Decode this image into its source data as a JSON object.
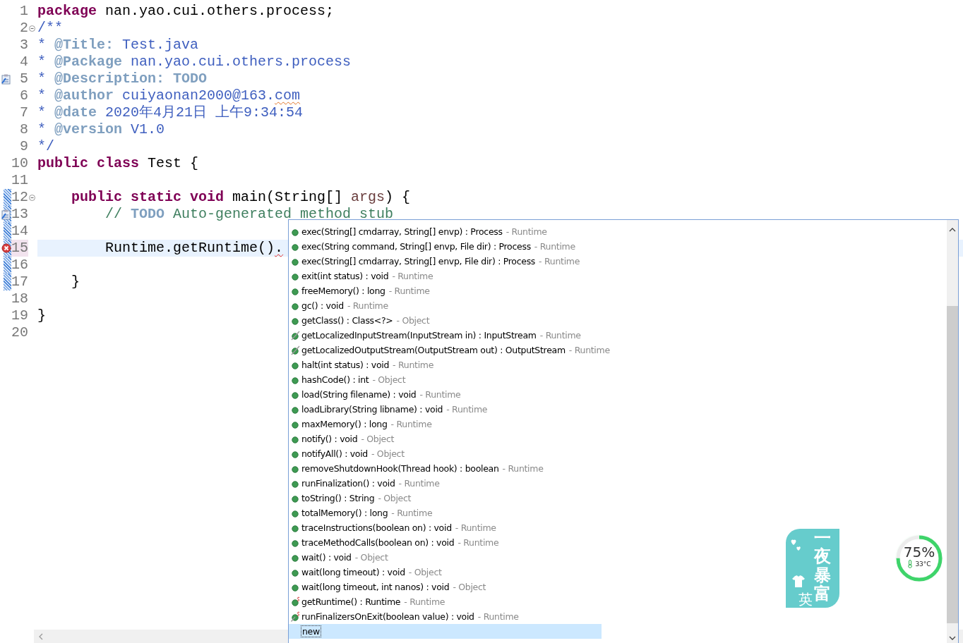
{
  "editor": {
    "lines": [
      {
        "number": "1",
        "segments": [
          {
            "kind": "keyword",
            "text": "package"
          },
          {
            "kind": "plain",
            "text": " nan.yao.cui.others.process;"
          }
        ]
      },
      {
        "number": "2",
        "fold": true,
        "segments": [
          {
            "kind": "doc",
            "text": "/**"
          }
        ]
      },
      {
        "number": "3",
        "segments": [
          {
            "kind": "doc",
            "text": "* "
          },
          {
            "kind": "doc-tag",
            "text": "@Title:"
          },
          {
            "kind": "doc",
            "text": " Test.java"
          }
        ]
      },
      {
        "number": "4",
        "segments": [
          {
            "kind": "doc",
            "text": "* "
          },
          {
            "kind": "doc-tag",
            "text": "@Package"
          },
          {
            "kind": "doc",
            "text": " nan.yao.cui.others.process"
          }
        ]
      },
      {
        "number": "5",
        "task": true,
        "segments": [
          {
            "kind": "doc",
            "text": "* "
          },
          {
            "kind": "doc-tag",
            "text": "@Description:"
          },
          {
            "kind": "doc-tag",
            "text": " TODO"
          }
        ]
      },
      {
        "number": "6",
        "segments": [
          {
            "kind": "doc",
            "text": "* "
          },
          {
            "kind": "doc-tag",
            "text": "@author"
          },
          {
            "kind": "doc",
            "text": " cuiyaonan2000@163."
          },
          {
            "kind": "doc",
            "text": "com",
            "misspelled": true
          }
        ]
      },
      {
        "number": "7",
        "segments": [
          {
            "kind": "doc",
            "text": "* "
          },
          {
            "kind": "doc-tag",
            "text": "@date"
          },
          {
            "kind": "doc",
            "text": " 2020年4月21日 上午9:34:54"
          }
        ]
      },
      {
        "number": "8",
        "segments": [
          {
            "kind": "doc",
            "text": "* "
          },
          {
            "kind": "doc-tag",
            "text": "@version"
          },
          {
            "kind": "doc",
            "text": " V1.0"
          }
        ]
      },
      {
        "number": "9",
        "segments": [
          {
            "kind": "doc",
            "text": "*/"
          }
        ]
      },
      {
        "number": "10",
        "segments": [
          {
            "kind": "keyword",
            "text": "public class"
          },
          {
            "kind": "plain",
            "text": " Test {"
          }
        ]
      },
      {
        "number": "11"
      },
      {
        "number": "12",
        "fold": true,
        "changed": true,
        "segments": [
          {
            "kind": "keyword",
            "text": "    public static void"
          },
          {
            "kind": "plain",
            "text": " main(String[] "
          },
          {
            "kind": "param",
            "text": "args"
          },
          {
            "kind": "plain",
            "text": ") {"
          }
        ]
      },
      {
        "number": "13",
        "changed": true,
        "task": true,
        "segments": [
          {
            "kind": "comment",
            "text": "        // "
          },
          {
            "kind": "task-tag",
            "text": "TODO"
          },
          {
            "kind": "comment",
            "text": " Auto-generated method stub"
          }
        ]
      },
      {
        "number": "14",
        "changed": true
      },
      {
        "number": "15",
        "current": true,
        "changed": true,
        "error": true,
        "segments": [
          {
            "kind": "plain",
            "text": "        Runtime.getRuntime()"
          },
          {
            "kind": "plain",
            "text": ".",
            "error": true
          }
        ]
      },
      {
        "number": "16",
        "changed": true
      },
      {
        "number": "17",
        "changed": true,
        "segments": [
          {
            "kind": "plain",
            "text": "    }"
          }
        ]
      },
      {
        "number": "18"
      },
      {
        "number": "19",
        "segments": [
          {
            "kind": "plain",
            "text": "}"
          }
        ]
      },
      {
        "number": "20"
      }
    ]
  },
  "proposals": [
    {
      "kind": "method",
      "signature": "exec(String[] cmdarray, String[] envp) : Process",
      "owner": "- Runtime",
      "selected": false
    },
    {
      "kind": "method",
      "signature": "exec(String command, String[] envp, File dir) : Process",
      "owner": "- Runtime",
      "selected": false
    },
    {
      "kind": "method",
      "signature": "exec(String[] cmdarray, String[] envp, File dir) : Process",
      "owner": "- Runtime",
      "selected": false
    },
    {
      "kind": "method",
      "signature": "exit(int status) : void",
      "owner": "- Runtime",
      "selected": false
    },
    {
      "kind": "method",
      "signature": "freeMemory() : long",
      "owner": "- Runtime",
      "selected": false
    },
    {
      "kind": "method",
      "signature": "gc() : void",
      "owner": "- Runtime",
      "selected": false
    },
    {
      "kind": "method",
      "signature": "getClass() : Class<?>",
      "owner": "- Object",
      "selected": false
    },
    {
      "kind": "deprecated",
      "signature": "getLocalizedInputStream(InputStream in) : InputStream",
      "owner": "- Runtime",
      "selected": false
    },
    {
      "kind": "deprecated",
      "signature": "getLocalizedOutputStream(OutputStream out) : OutputStream",
      "owner": "- Runtime",
      "selected": false
    },
    {
      "kind": "method",
      "signature": "halt(int status) : void",
      "owner": "- Runtime",
      "selected": false
    },
    {
      "kind": "method",
      "signature": "hashCode() : int",
      "owner": "- Object",
      "selected": false
    },
    {
      "kind": "method",
      "signature": "load(String filename) : void",
      "owner": "- Runtime",
      "selected": false
    },
    {
      "kind": "method",
      "signature": "loadLibrary(String libname) : void",
      "owner": "- Runtime",
      "selected": false
    },
    {
      "kind": "method",
      "signature": "maxMemory() : long",
      "owner": "- Runtime",
      "selected": false
    },
    {
      "kind": "method",
      "signature": "notify() : void",
      "owner": "- Object",
      "selected": false
    },
    {
      "kind": "method",
      "signature": "notifyAll() : void",
      "owner": "- Object",
      "selected": false
    },
    {
      "kind": "method",
      "signature": "removeShutdownHook(Thread hook) : boolean",
      "owner": "- Runtime",
      "selected": false
    },
    {
      "kind": "method",
      "signature": "runFinalization() : void",
      "owner": "- Runtime",
      "selected": false
    },
    {
      "kind": "method",
      "signature": "toString() : String",
      "owner": "- Object",
      "selected": false
    },
    {
      "kind": "method",
      "signature": "totalMemory() : long",
      "owner": "- Runtime",
      "selected": false
    },
    {
      "kind": "method",
      "signature": "traceInstructions(boolean on) : void",
      "owner": "- Runtime",
      "selected": false
    },
    {
      "kind": "method",
      "signature": "traceMethodCalls(boolean on) : void",
      "owner": "- Runtime",
      "selected": false
    },
    {
      "kind": "method",
      "signature": "wait() : void",
      "owner": "- Object",
      "selected": false
    },
    {
      "kind": "method",
      "signature": "wait(long timeout) : void",
      "owner": "- Object",
      "selected": false
    },
    {
      "kind": "method",
      "signature": "wait(long timeout, int nanos) : void",
      "owner": "- Object",
      "selected": false
    },
    {
      "kind": "static",
      "signature": "getRuntime() : Runtime",
      "owner": "- Runtime",
      "selected": false
    },
    {
      "kind": "static-deprecated",
      "signature": "runFinalizersOnExit(boolean value) : void",
      "owner": "- Runtime",
      "selected": false
    },
    {
      "kind": "template",
      "signature": "new",
      "selected": true
    }
  ],
  "sticker": {
    "title": "一夜暴富",
    "mark": "英"
  },
  "monitor": {
    "reading": "75%",
    "level": 0.75,
    "temperature": "33°C"
  }
}
